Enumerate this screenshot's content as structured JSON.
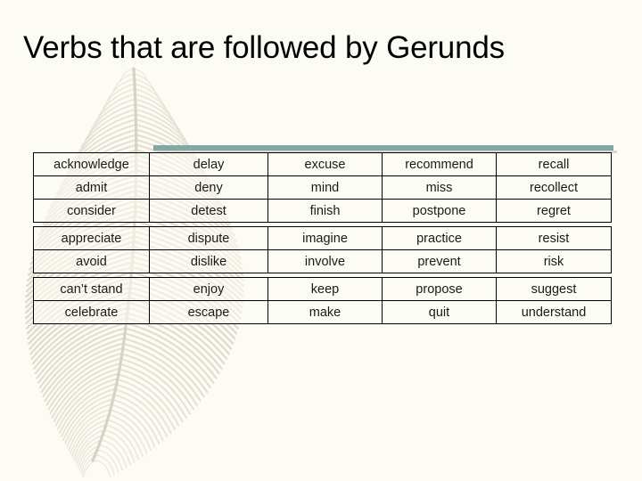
{
  "slide": {
    "title": "Verbs that are followed by Gerunds",
    "background_color": "#fdfcf4",
    "accent_color": "#83a8a6",
    "text_color": "#000000"
  },
  "decoration": {
    "feather_icon": "feather-watermark-icon",
    "feather_color": "#dedbcd"
  },
  "table": {
    "columns": 5,
    "groups": [
      {
        "rows": [
          [
            "acknowledge",
            "delay",
            "excuse",
            "recommend",
            "recall"
          ],
          [
            "admit",
            "deny",
            "mind",
            "miss",
            "recollect"
          ],
          [
            "consider",
            "detest",
            "finish",
            "postpone",
            "regret"
          ]
        ]
      },
      {
        "rows": [
          [
            "appreciate",
            "dispute",
            "imagine",
            "practice",
            "resist"
          ],
          [
            "avoid",
            "dislike",
            "involve",
            "prevent",
            "risk"
          ]
        ]
      },
      {
        "rows": [
          [
            "can’t stand",
            "enjoy",
            "keep",
            "propose",
            "suggest"
          ],
          [
            "celebrate",
            "escape",
            "make",
            "quit",
            "understand"
          ]
        ]
      }
    ]
  }
}
